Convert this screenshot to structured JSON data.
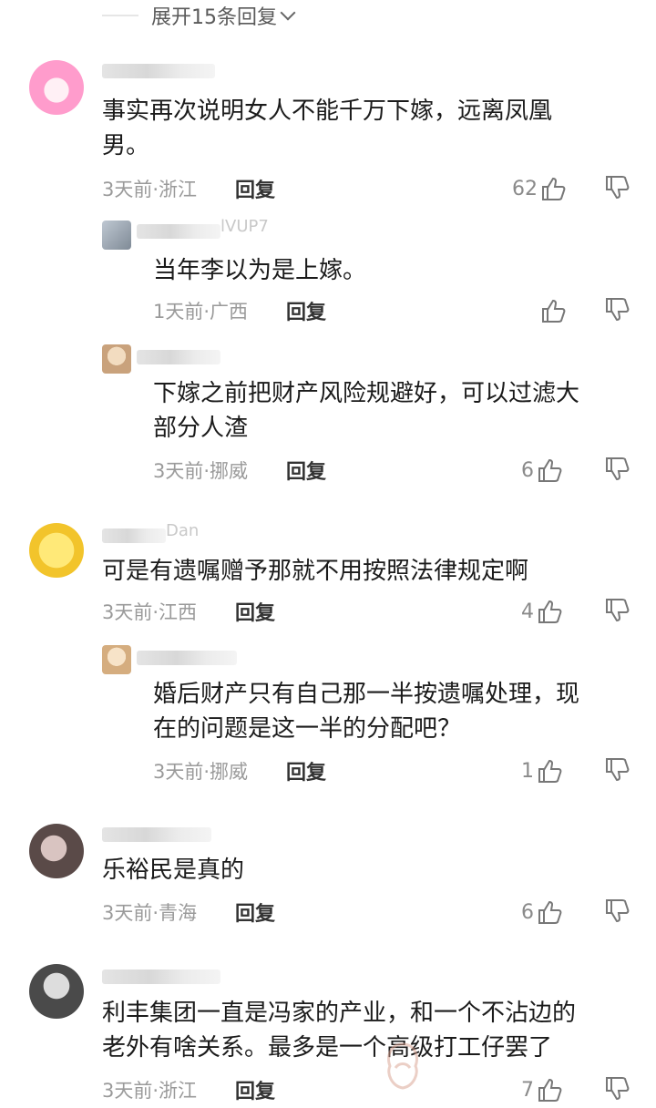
{
  "expand_label": "展开15条回复",
  "comments": [
    {
      "name": "",
      "content_line1": "事实再次说明女人不能千万下嫁，远离凤凰",
      "content_line2": "男。",
      "meta": "3天前·浙江",
      "reply": "回复",
      "likes": "62"
    },
    {
      "name": "",
      "name_partial": "lVUP7",
      "content": "当年李以为是上嫁。",
      "meta": "1天前·广西",
      "reply": "回复",
      "likes": ""
    },
    {
      "name": "",
      "content_line1": "下嫁之前把财产风险规避好，可以过滤大",
      "content_line2": "部分人渣",
      "meta": "3天前·挪威",
      "reply": "回复",
      "likes": "6"
    },
    {
      "name": "",
      "name_partial": "Dan",
      "content": "可是有遗嘱赠予那就不用按照法律规定啊",
      "meta": "3天前·江西",
      "reply": "回复",
      "likes": "4"
    },
    {
      "name": "",
      "content_line1": "婚后财产只有自己那一半按遗嘱处理，现",
      "content_line2": "在的问题是这一半的分配吧？",
      "meta": "3天前·挪威",
      "reply": "回复",
      "likes": "1"
    },
    {
      "name": "",
      "content": "乐裕民是真的",
      "meta": "3天前·青海",
      "reply": "回复",
      "likes": "6"
    },
    {
      "name": "",
      "content_line1": "利丰集团一直是冯家的产业，和一个不沾边的",
      "content_line2": "老外有啥关系。最多是一个高级打工仔罢了",
      "meta": "3天前·浙江",
      "reply": "回复",
      "likes": "7"
    }
  ],
  "icons": {
    "like": "thumbs-up-icon",
    "dislike": "thumbs-down-icon",
    "chevron": "chevron-down-icon"
  }
}
